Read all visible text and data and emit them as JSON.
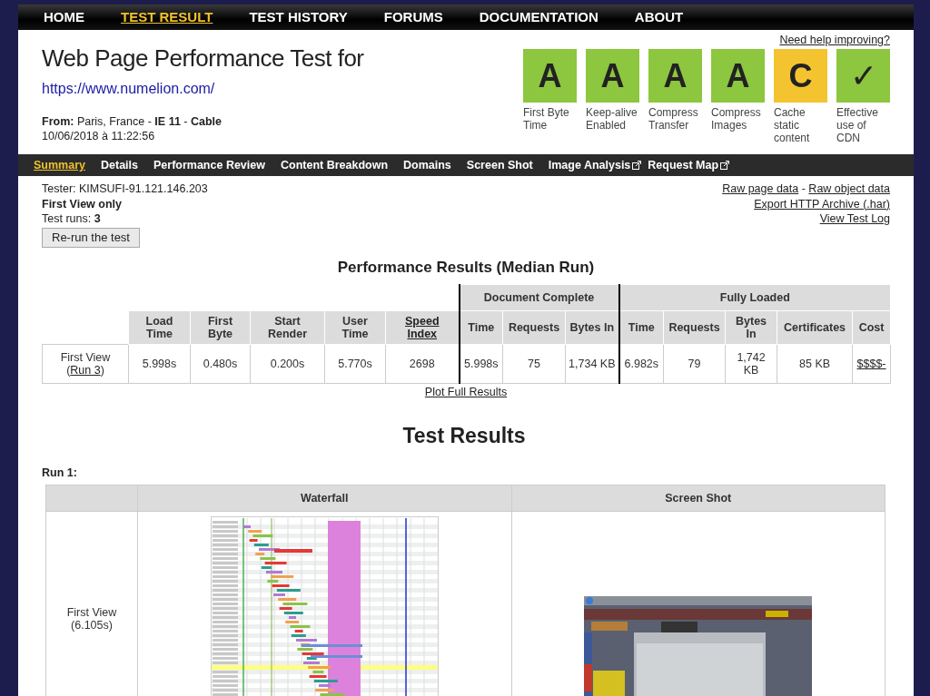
{
  "top_nav": [
    {
      "label": "HOME",
      "selected": false
    },
    {
      "label": "TEST RESULT",
      "selected": true
    },
    {
      "label": "TEST HISTORY",
      "selected": false
    },
    {
      "label": "FORUMS",
      "selected": false
    },
    {
      "label": "DOCUMENTATION",
      "selected": false
    },
    {
      "label": "ABOUT",
      "selected": false
    }
  ],
  "header": {
    "title": "Web Page Performance Test for",
    "url": "https://www.numelion.com/",
    "from": "**From:** Paris, France - **IE 11** - **Cable**",
    "date": "10/06/2018 à 11:22:56",
    "help_link": "Need help improving?"
  },
  "grades": [
    {
      "grade": "A",
      "label": "First Byte Time",
      "color": "#8dc63f"
    },
    {
      "grade": "A",
      "label": "Keep-alive Enabled",
      "color": "#8dc63f"
    },
    {
      "grade": "A",
      "label": "Compress Transfer",
      "color": "#8dc63f"
    },
    {
      "grade": "A",
      "label": "Compress Images",
      "color": "#8dc63f"
    },
    {
      "grade": "C",
      "label": "Cache static content",
      "color": "#f4c430"
    },
    {
      "grade": "✓",
      "label": "Effective use of CDN",
      "color": "#8dc63f"
    }
  ],
  "sub_nav": [
    {
      "label": "Summary",
      "selected": true,
      "external": false
    },
    {
      "label": "Details",
      "selected": false,
      "external": false
    },
    {
      "label": "Performance Review",
      "selected": false,
      "external": false
    },
    {
      "label": "Content Breakdown",
      "selected": false,
      "external": false
    },
    {
      "label": "Domains",
      "selected": false,
      "external": false
    },
    {
      "label": "Screen Shot",
      "selected": false,
      "external": false
    },
    {
      "label": "Image Analysis",
      "selected": false,
      "external": true
    },
    {
      "label": "Request Map",
      "selected": false,
      "external": true
    }
  ],
  "test_info": {
    "tester": "Tester: KIMSUFI-91.121.146.203",
    "view": "First View only",
    "runs": "Test runs: **3**",
    "rerun_button": "Re-run the test",
    "link_rows": [
      {
        "links": [
          "Raw page data",
          "Raw object data"
        ],
        "separator": "-"
      },
      {
        "links": [
          "Export HTTP Archive (.har)"
        ]
      },
      {
        "links": [
          "View Test Log"
        ]
      }
    ]
  },
  "results": {
    "title": "Performance Results (Median Run)",
    "groups": [
      {
        "columns": [
          {
            "label": "Load Time",
            "link": false
          },
          {
            "label": "First Byte",
            "link": false
          },
          {
            "label": "Start Render",
            "link": false
          },
          {
            "label": "User Time",
            "link": false
          },
          {
            "label": "Speed Index",
            "link": true
          }
        ]
      },
      {
        "label": "Document Complete",
        "columns": [
          {
            "label": "Time",
            "link": false
          },
          {
            "label": "Requests",
            "link": false
          },
          {
            "label": "Bytes In",
            "link": false
          }
        ]
      },
      {
        "label": "Fully Loaded",
        "columns": [
          {
            "label": "Time",
            "link": false
          },
          {
            "label": "Requests",
            "link": false
          },
          {
            "label": "Bytes In",
            "link": false
          },
          {
            "label": "Certificates",
            "link": false
          },
          {
            "label": "Cost",
            "link": false
          }
        ]
      }
    ],
    "rows": [
      {
        "label": "First View (",
        "run_link": "Run 3",
        "label_end": ")",
        "cells": [
          {
            "value": "5.998s",
            "link": false
          },
          {
            "value": "0.480s",
            "link": false
          },
          {
            "value": "0.200s",
            "link": false
          },
          {
            "value": "5.770s",
            "link": false
          },
          {
            "value": "2698",
            "link": false
          },
          {
            "value": "5.998s",
            "link": false
          },
          {
            "value": "75",
            "link": false
          },
          {
            "value": "1,734 KB",
            "link": false
          },
          {
            "value": "6.982s",
            "link": false
          },
          {
            "value": "79",
            "link": false
          },
          {
            "value": "1,742 KB",
            "link": false
          },
          {
            "value": "85 KB",
            "link": false
          },
          {
            "value": "$$$$-",
            "link": true
          }
        ]
      }
    ],
    "plot_link": "Plot Full Results"
  },
  "test_results": {
    "title": "Test Results",
    "runs": [
      {
        "label": "Run 1:",
        "columns": [
          "Waterfall",
          "Screen Shot"
        ],
        "rows": [
          {
            "label": "First View",
            "time": "(6.105s)"
          }
        ]
      }
    ]
  }
}
